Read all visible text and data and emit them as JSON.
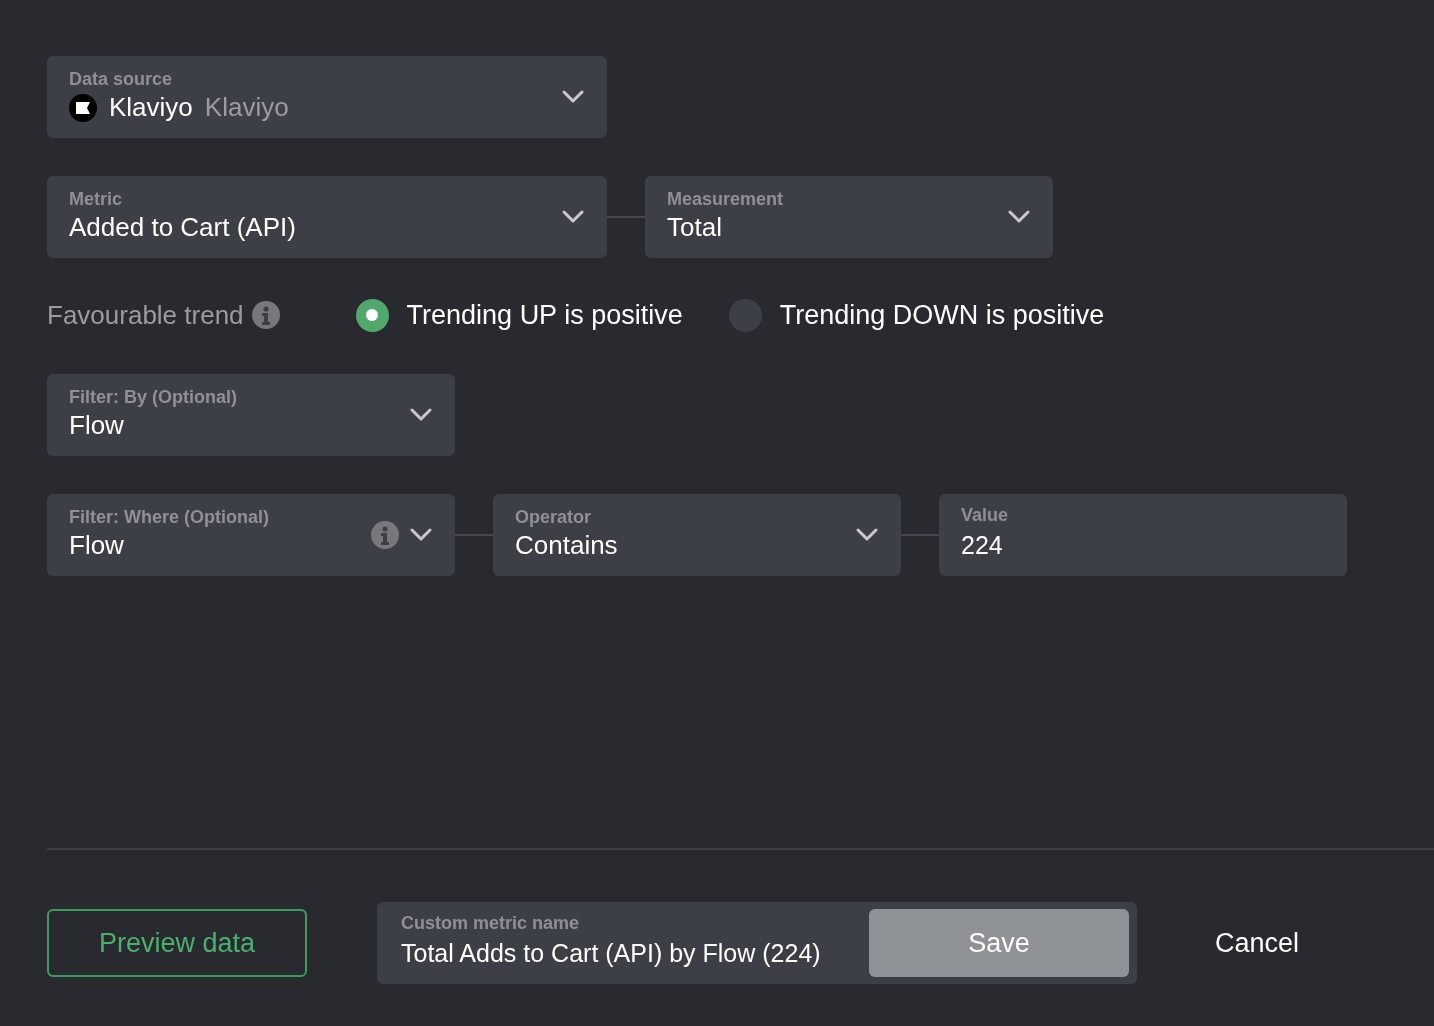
{
  "sections": [
    {
      "kind": "fields",
      "fields": [
        {
          "kind": "select",
          "label": "Data source",
          "value": "Klaviyo",
          "secondary": "Klaviyo",
          "logo": true,
          "info": false
        }
      ]
    },
    {
      "kind": "fields",
      "fields": [
        {
          "kind": "select",
          "label": "Metric",
          "value": "Added to Cart (API)",
          "info": false
        },
        {
          "kind": "select",
          "label": "Measurement",
          "value": "Total",
          "info": false
        }
      ]
    },
    {
      "kind": "trend",
      "label": "Favourable trend",
      "options": [
        {
          "label": "Trending UP is positive",
          "selected": true
        },
        {
          "label": "Trending DOWN is positive",
          "selected": false
        }
      ]
    },
    {
      "kind": "fields",
      "fields": [
        {
          "kind": "select",
          "label": "Filter: By (Optional)",
          "value": "Flow",
          "info": false
        }
      ]
    },
    {
      "kind": "fields",
      "fields": [
        {
          "kind": "select",
          "label": "Filter: Where (Optional)",
          "value": "Flow",
          "info": true
        },
        {
          "kind": "select",
          "label": "Operator",
          "value": "Contains",
          "info": false
        },
        {
          "kind": "input",
          "label": "Value",
          "value": "224",
          "info": false
        }
      ]
    }
  ],
  "footer": {
    "preview": "Preview data",
    "name_field": {
      "label": "Custom metric name",
      "value": "Total Adds to Cart (API) by Flow (224)"
    },
    "save": "Save",
    "cancel": "Cancel"
  }
}
